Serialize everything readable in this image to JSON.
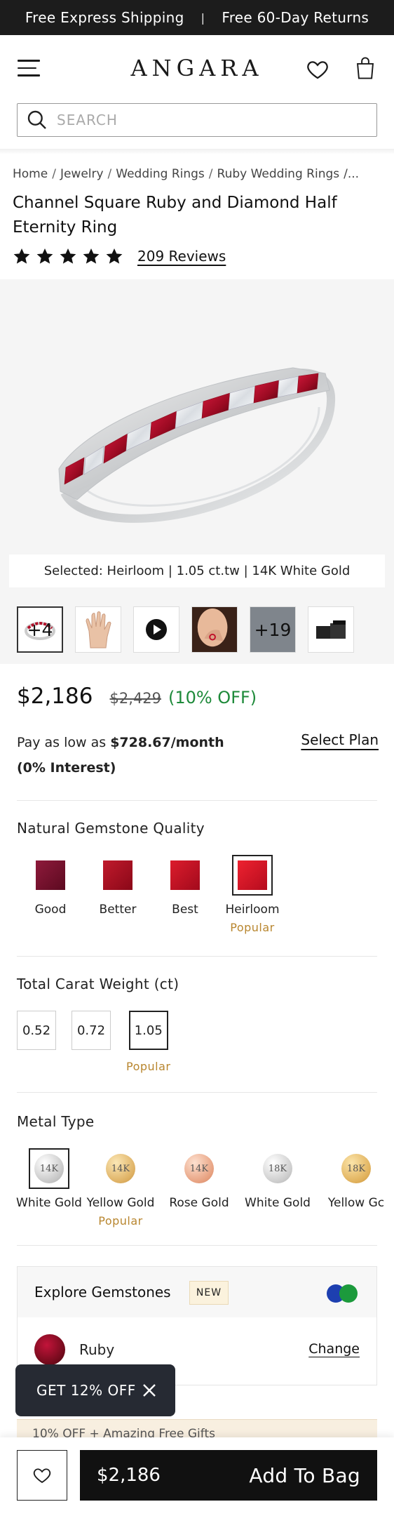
{
  "promo": {
    "left": "Free Express Shipping",
    "separator": "|",
    "right": "Free 60-Day Returns"
  },
  "header": {
    "logo": "ANGARA",
    "menu_icon": "hamburger-menu-icon",
    "wishlist_icon": "heart-icon",
    "bag_icon": "shopping-bag-icon"
  },
  "search": {
    "placeholder": "SEARCH"
  },
  "breadcrumb": {
    "items": [
      "Home",
      "Jewelry",
      "Wedding Rings",
      "Ruby Wedding Rings"
    ],
    "separator": "/",
    "overflow": "/..."
  },
  "product": {
    "title": "Channel Square Ruby and Diamond Half Eternity Ring",
    "rating_stars": 5,
    "reviews": "209 Reviews",
    "selected": "Selected: Heirloom | 1.05 ct.tw | 14K White Gold",
    "thumbnails": [
      {
        "name": "ring-view-thumb",
        "overlay": "+4"
      },
      {
        "name": "hand-model-thumb",
        "overlay": ""
      },
      {
        "name": "video-thumb",
        "overlay": ""
      },
      {
        "name": "wearing-thumb",
        "overlay": ""
      },
      {
        "name": "gallery-thumb",
        "overlay": "+19"
      },
      {
        "name": "box-thumb",
        "overlay": ""
      }
    ]
  },
  "pricing": {
    "price": "$2,186",
    "old_price": "$2,429",
    "discount": "(10% OFF)",
    "pay_prefix": "Pay as low as",
    "pay_amount": "$728.67/month",
    "pay_interest": "(0% Interest)",
    "select_plan": "Select Plan"
  },
  "quality": {
    "title": "Natural Gemstone Quality",
    "options": [
      {
        "label": "Good",
        "color": "#7a0f2e",
        "badge": ""
      },
      {
        "label": "Better",
        "color": "#a4101f",
        "badge": ""
      },
      {
        "label": "Best",
        "color": "#c0101e",
        "badge": ""
      },
      {
        "label": "Heirloom",
        "color": "#d51421",
        "badge": "Popular"
      }
    ],
    "selected": "Heirloom"
  },
  "carat": {
    "title": "Total Carat Weight (ct)",
    "options": [
      {
        "label": "0.52",
        "badge": ""
      },
      {
        "label": "0.72",
        "badge": ""
      },
      {
        "label": "1.05",
        "badge": "Popular"
      }
    ],
    "selected": "1.05"
  },
  "metal": {
    "title": "Metal Type",
    "options": [
      {
        "karat": "14K",
        "label": "White Gold",
        "color": "#cfcfcf",
        "badge": ""
      },
      {
        "karat": "14K",
        "label": "Yellow Gold",
        "color": "#e2b96a",
        "badge": "Popular"
      },
      {
        "karat": "14K",
        "label": "Rose Gold",
        "color": "#e7a383",
        "badge": ""
      },
      {
        "karat": "18K",
        "label": "White Gold",
        "color": "#d3d3d3",
        "badge": ""
      },
      {
        "karat": "18K",
        "label": "Yellow Gc",
        "color": "#e3b764",
        "badge": ""
      }
    ],
    "selected": "14K White Gold"
  },
  "explore": {
    "title": "Explore Gemstones",
    "badge": "NEW",
    "gem": "Ruby",
    "change": "Change"
  },
  "offer_strip": "10% OFF + Amazing Free Gifts",
  "toast": {
    "label": "GET 12% OFF",
    "close_icon": "close-icon"
  },
  "bottom_bar": {
    "price": "$2,186",
    "cta": "Add To Bag"
  },
  "colors": {
    "discount": "#1e8a3a",
    "popular": "#b8862f",
    "dark": "#111111",
    "promo_bg": "#1c1c1c"
  }
}
